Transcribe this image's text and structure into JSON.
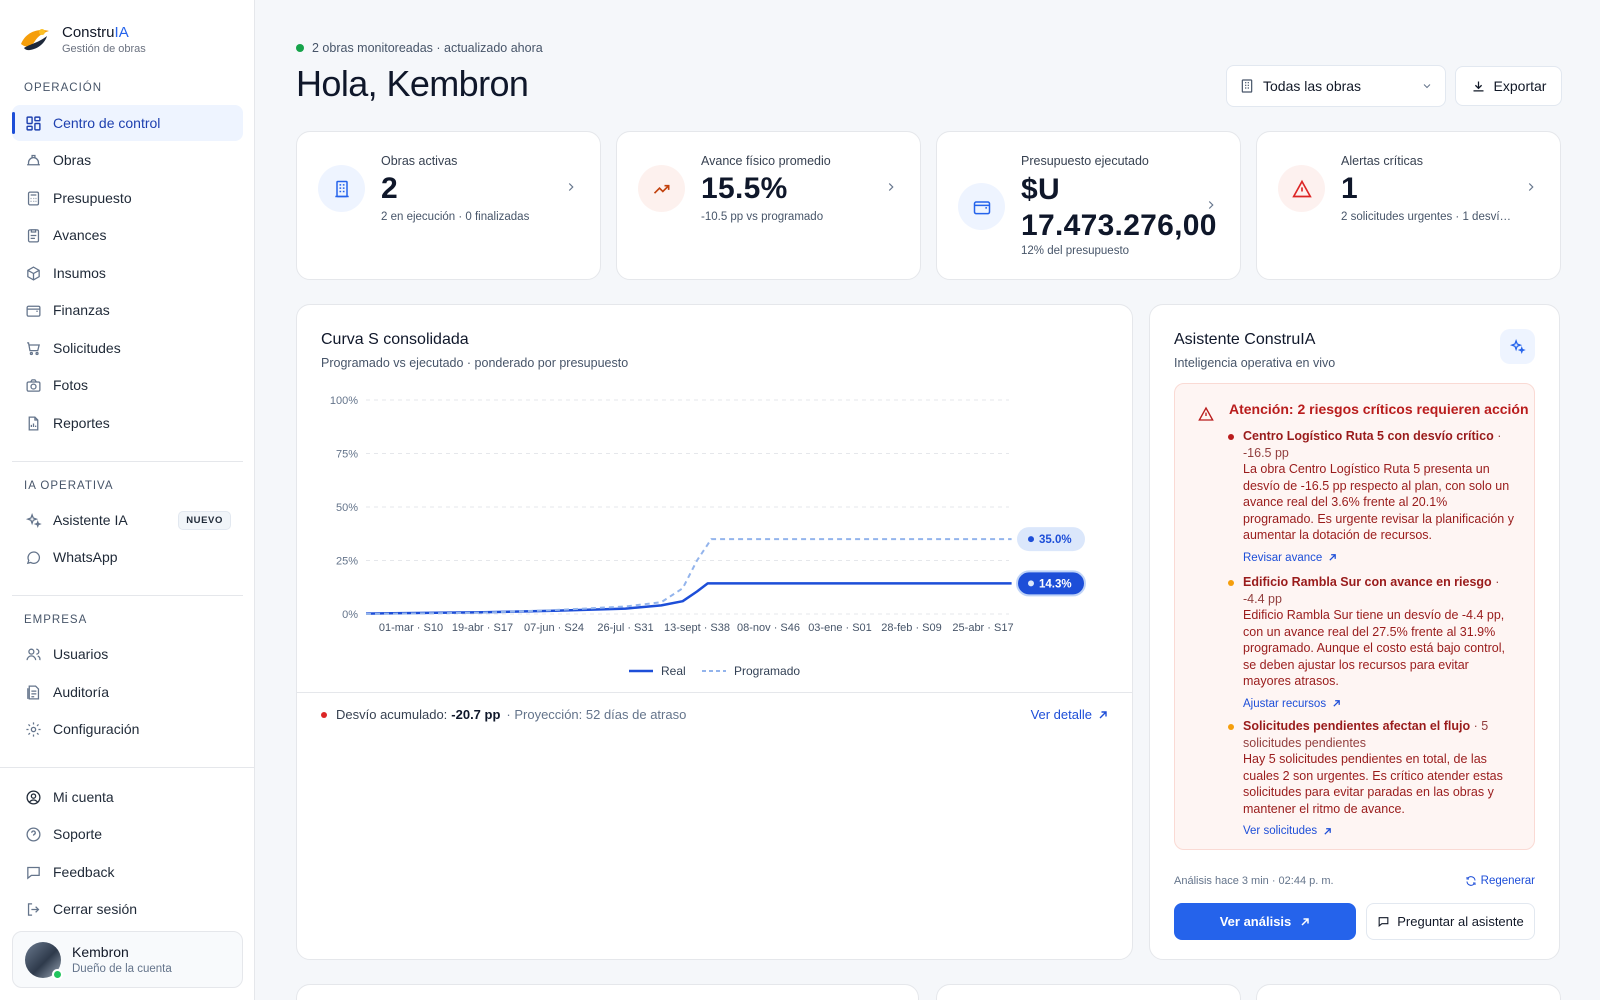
{
  "brand": {
    "name_prefix": "Constru",
    "name_accent": "IA",
    "subtitle": "Gestión de obras"
  },
  "sidebar": {
    "section_operacion": "OPERACIÓN",
    "operacion": [
      {
        "label": "Centro de control",
        "icon": "dashboard-icon",
        "active": true
      },
      {
        "label": "Obras",
        "icon": "helmet-icon"
      },
      {
        "label": "Presupuesto",
        "icon": "calculator-icon"
      },
      {
        "label": "Avances",
        "icon": "clipboard-icon"
      },
      {
        "label": "Insumos",
        "icon": "package-icon"
      },
      {
        "label": "Finanzas",
        "icon": "wallet-icon"
      },
      {
        "label": "Solicitudes",
        "icon": "cart-icon"
      },
      {
        "label": "Fotos",
        "icon": "camera-icon"
      },
      {
        "label": "Reportes",
        "icon": "report-icon"
      }
    ],
    "section_ia": "IA OPERATIVA",
    "ia": [
      {
        "label": "Asistente IA",
        "icon": "sparkle-icon",
        "badge": "NUEVO"
      },
      {
        "label": "WhatsApp",
        "icon": "chat-bubble-icon"
      }
    ],
    "section_empresa": "EMPRESA",
    "empresa": [
      {
        "label": "Usuarios",
        "icon": "users-icon"
      },
      {
        "label": "Auditoría",
        "icon": "audit-icon"
      },
      {
        "label": "Configuración",
        "icon": "gear-icon"
      }
    ],
    "footer": [
      {
        "label": "Mi cuenta",
        "icon": "user-circle-icon"
      },
      {
        "label": "Soporte",
        "icon": "help-icon"
      },
      {
        "label": "Feedback",
        "icon": "message-icon"
      },
      {
        "label": "Cerrar sesión",
        "icon": "logout-icon"
      }
    ],
    "user": {
      "name": "Kembron",
      "role": "Dueño de la cuenta"
    }
  },
  "header": {
    "status": "2 obras monitoreadas · actualizado ahora",
    "greeting": "Hola, Kembron",
    "filter_value": "Todas las obras",
    "export_label": "Exportar"
  },
  "kpis": [
    {
      "label": "Obras activas",
      "value": "2",
      "sub": "2 en ejecución · 0 finalizadas",
      "icon": "building-icon",
      "color": "#2563eb"
    },
    {
      "label": "Avance físico promedio",
      "value": "15.5%",
      "sub": "-10.5 pp vs programado",
      "icon": "trending-up-icon",
      "color": "#c2410c"
    },
    {
      "label": "Presupuesto ejecutado",
      "value": "$U 17.473.276,00",
      "sub": "12% del presupuesto",
      "icon": "wallet-icon",
      "color": "#2563eb"
    },
    {
      "label": "Alertas críticas",
      "value": "1",
      "sub": "2 solicitudes urgentes · 1 desví…",
      "icon": "alert-triangle-icon",
      "color": "#dc2626"
    }
  ],
  "chart": {
    "title": "Curva S consolidada",
    "subtitle": "Programado vs ejecutado · ponderado por presupuesto",
    "legend_real": "Real",
    "legend_programado": "Programado",
    "footer_label": "Desvío acumulado:",
    "footer_value": "-20.7 pp",
    "footer_projection": "· Proyección: 52 días de atraso",
    "footer_link": "Ver detalle"
  },
  "chart_data": {
    "type": "line",
    "x_ticks": [
      "01-mar · S10",
      "19-abr · S17",
      "07-jun · S24",
      "26-jul · S31",
      "13-sept · S38",
      "08-nov · S46",
      "03-ene · S01",
      "28-feb · S09",
      "25-abr · S17"
    ],
    "y_ticks": [
      "0%",
      "25%",
      "50%",
      "75%",
      "100%"
    ],
    "ylim": [
      0,
      100
    ],
    "series": [
      {
        "name": "Real",
        "color": "#1d4ed8",
        "style": "solid",
        "end_label": "14.3%",
        "points": [
          [
            0,
            0.2
          ],
          [
            1,
            0.8
          ],
          [
            2,
            1.5
          ],
          [
            3,
            2.5
          ],
          [
            3.5,
            4
          ],
          [
            3.8,
            6
          ],
          [
            4,
            10.5
          ],
          [
            4.15,
            14.3
          ],
          [
            5,
            14.3
          ],
          [
            6,
            14.3
          ],
          [
            7,
            14.3
          ],
          [
            8.4,
            14.3
          ]
        ]
      },
      {
        "name": "Programado",
        "color": "#93b4ec",
        "style": "dashed",
        "end_label": "35.0%",
        "points": [
          [
            0,
            0
          ],
          [
            1,
            0.6
          ],
          [
            2,
            1.8
          ],
          [
            3,
            3.5
          ],
          [
            3.5,
            5.5
          ],
          [
            3.8,
            12
          ],
          [
            4,
            25
          ],
          [
            4.2,
            35
          ],
          [
            5,
            35
          ],
          [
            6,
            35
          ],
          [
            7,
            35
          ],
          [
            8.4,
            35
          ]
        ]
      }
    ],
    "grid": true,
    "legend": "bottom-center"
  },
  "assistant": {
    "title": "Asistente ConstruIA",
    "subtitle": "Inteligencia operativa en vivo",
    "alert_title": "Atención: 2 riesgos críticos requieren acción",
    "risks": [
      {
        "title": "Centro Logístico Ruta 5 con desvío crítico",
        "meta": "· -16.5 pp",
        "color": "#b91c1c",
        "desc": "La obra Centro Logístico Ruta 5 presenta un desvío de -16.5 pp respecto al plan, con solo un avance real del 3.6% frente al 20.1% programado. Es urgente revisar la planificación y aumentar la dotación de recursos.",
        "action": "Revisar avance"
      },
      {
        "title": "Edificio Rambla Sur con avance en riesgo",
        "meta": "· -4.4 pp",
        "color": "#f59e0b",
        "desc": "Edificio Rambla Sur tiene un desvío de -4.4 pp, con un avance real del 27.5% frente al 31.9% programado. Aunque el costo está bajo control, se deben ajustar los recursos para evitar mayores atrasos.",
        "action": "Ajustar recursos"
      },
      {
        "title": "Solicitudes pendientes afectan el flujo",
        "meta": "· 5 solicitudes pendientes",
        "color": "#f59e0b",
        "desc": "Hay 5 solicitudes pendientes en total, de las cuales 2 son urgentes. Es crítico atender estas solicitudes para evitar paradas en las obras y mantener el ritmo de avance.",
        "action": "Ver solicitudes"
      }
    ],
    "analysis_time": "Análisis hace 3 min · 02:44 p. m.",
    "regen_label": "Regenerar",
    "primary_label": "Ver análisis",
    "secondary_label": "Preguntar al asistente"
  }
}
